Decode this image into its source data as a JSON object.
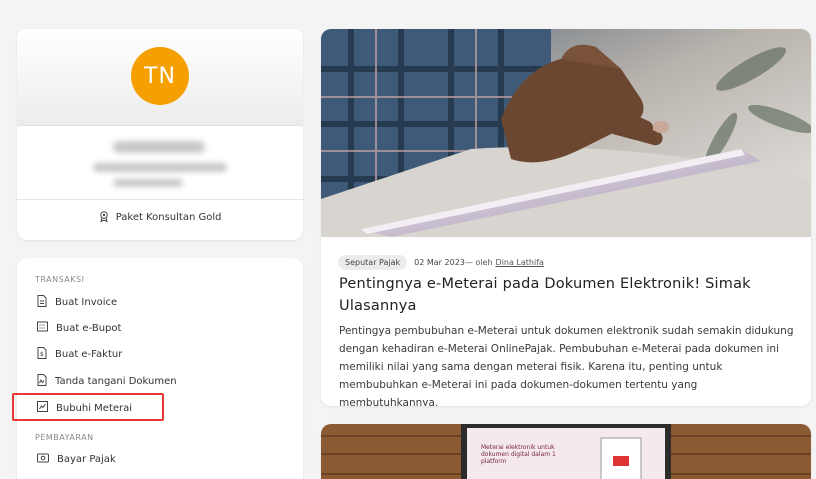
{
  "profile": {
    "initials": "TN",
    "package_label": "Paket Konsultan Gold"
  },
  "menu": {
    "sections": [
      {
        "title": "TRANSAKSI",
        "items": [
          {
            "label": "Buat Invoice",
            "icon": "invoice-icon"
          },
          {
            "label": "Buat e-Bupot",
            "icon": "bupot-icon"
          },
          {
            "label": "Buat e-Faktur",
            "icon": "faktur-icon"
          },
          {
            "label": "Tanda tangani Dokumen",
            "icon": "sign-document-icon"
          },
          {
            "label": "Bubuhi Meterai",
            "icon": "stamp-duty-icon"
          }
        ]
      },
      {
        "title": "PEMBAYARAN",
        "items": [
          {
            "label": "Bayar Pajak",
            "icon": "pay-tax-icon"
          }
        ]
      }
    ]
  },
  "article": {
    "category": "Seputar Pajak",
    "date": "02 Mar 2023",
    "by": " — oleh",
    "author": "Dina Lathifa",
    "title": "Pentingnya e-Meterai pada Dokumen Elektronik! Simak Ulasannya",
    "excerpt": "Pentingya pembubuhan e-Meterai untuk dokumen elektronik sudah semakin didukung dengan kehadiran e-Meterai OnlinePajak. Pembubuhan e-Meterai pada dokumen ini memiliki nilai yang sama dengan meterai fisik. Karena itu, penting untuk membubuhkan e-Meterai ini pada dokumen-dokumen tertentu yang membutuhkannya."
  },
  "article2": {
    "screen_text": "Meterai elektronik untuk dokumen digital dalam 1 platform"
  },
  "colors": {
    "avatar": "#f5a000",
    "highlight": "#e53935",
    "background": "#f4f4f5"
  }
}
